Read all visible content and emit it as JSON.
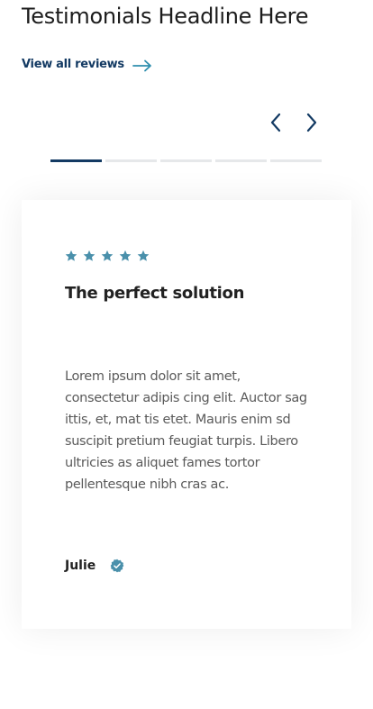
{
  "section": {
    "headline": "Testimonials Headline Here",
    "view_all_label": "View all reviews"
  },
  "icons": {
    "arrow": "arrow-right-icon",
    "prev": "chevron-left-icon",
    "next": "chevron-right-icon",
    "star": "star-icon",
    "verified": "verified-badge-icon"
  },
  "colors": {
    "navy": "#133a63",
    "star": "#4a90ab",
    "arrow": "#2f8fae"
  },
  "carousel": {
    "slide_count": 5,
    "active_slide": 1
  },
  "testimonial": {
    "rating": 5,
    "title": "The perfect solution",
    "body": "Lorem ipsum dolor sit amet, consectetur adipis cing elit. Auctor sag ittis, et, mat tis etet. Mauris enim sd suscipit pretium feugiat turpis. Libero ultricies  as aliquet fames tortor pellentesque nibh cras ac.",
    "author": "Julie"
  }
}
